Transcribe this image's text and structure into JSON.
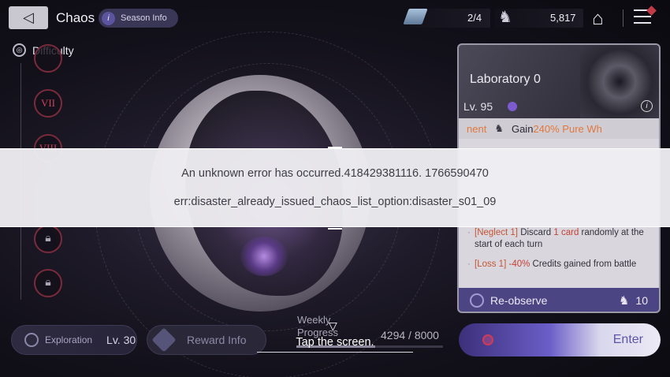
{
  "header": {
    "back_glyph": "◁",
    "title": "Chaos",
    "season_info_label": "Season Info",
    "season_info_icon": "i",
    "stamina_value": "2/4",
    "credits_value": "5,817",
    "home_glyph": "⌂"
  },
  "difficulty": {
    "label": "Difficulty",
    "tiers": [
      "VII",
      "VIII"
    ]
  },
  "stage_panel": {
    "title": "Laboratory 0",
    "level": "Lv. 95",
    "marquee_left": "nent",
    "marquee_gain": "Gain",
    "marquee_highlight": "240% Pure Wh",
    "effects": [
      {
        "tag": "[Neglect 1]",
        "pre": "Discard",
        "hl": "1 card",
        "post": "randomly at the start of each turn"
      },
      {
        "tag": "[Loss 1]",
        "pre": "",
        "hl": "-40%",
        "post": "Credits gained from battle"
      }
    ],
    "reobserve_label": "Re-observe",
    "reobserve_cost": "10"
  },
  "bottom": {
    "exploration_label": "Exploration",
    "exploration_level": "Lv. 30",
    "reward_label": "Reward Info",
    "weekly_label_1": "Weekly",
    "weekly_label_2": "Progress",
    "weekly_value": "4294 / 8000",
    "weekly_fraction": 0.537,
    "enter_label": "Enter"
  },
  "error": {
    "line1": "An unknown error has occurred.418429381116. 1766590470",
    "line2": "err:disaster_already_issued_chaos_list_option:disaster_s01_09"
  },
  "overlay": {
    "tap_glyph": "▽",
    "tap_text": "Tap the screen."
  },
  "colors": {
    "accent_purple": "#4c4583",
    "tier_red": "#c84356",
    "highlight_orange": "#e2783c"
  }
}
